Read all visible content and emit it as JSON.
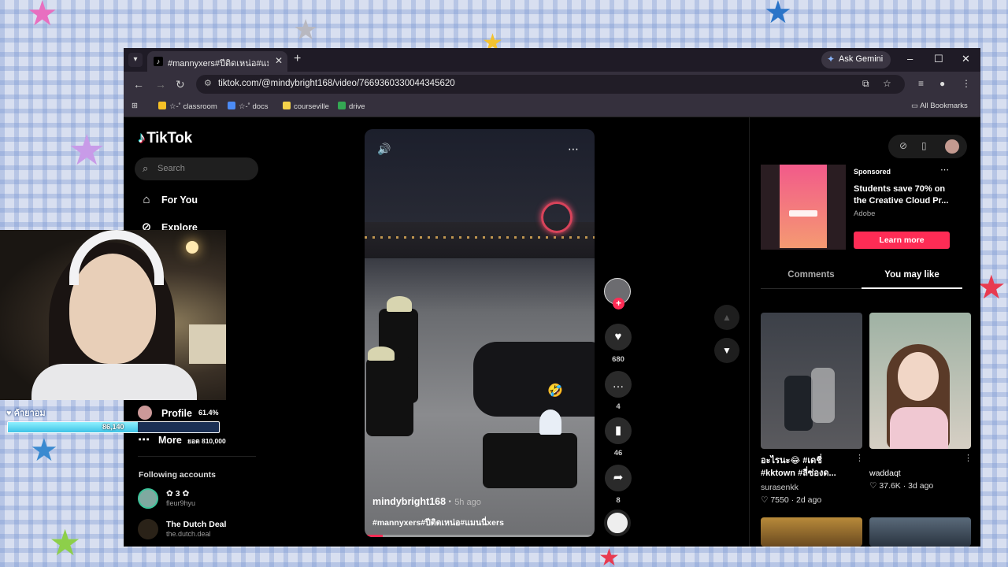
{
  "browser": {
    "tab_title": "#mannyxers#ปีติดเหน่อ#แมนนี่xers",
    "tab_favicon": "tiktok-icon",
    "gemini_label": "Ask Gemini",
    "url": "tiktok.com/@mindybright168/video/7669360330044345620",
    "bookmarks": [
      {
        "label": "☆-˚ classroom",
        "color": "#f6c026"
      },
      {
        "label": "☆-˚ docs",
        "color": "#4c8bf5"
      },
      {
        "label": "courseville",
        "color": "#f4d24a"
      },
      {
        "label": "drive",
        "color": "#34a853"
      }
    ],
    "all_bookmarks": "All Bookmarks"
  },
  "tiktok": {
    "logo": "TikTok",
    "search_placeholder": "Search",
    "nav": {
      "for_you": "For You",
      "explore": "Explore",
      "profile": "Profile",
      "more": "More"
    },
    "following_header": "Following accounts",
    "following": [
      {
        "name": "✿ 3 ✿",
        "handle": "fleur9hyu"
      },
      {
        "name": "The Dutch Deal",
        "handle": "the.dutch.deal"
      }
    ],
    "video": {
      "username": "mindybright168",
      "time": "5h ago",
      "caption": "#mannyxers#ปีติดเหน่อ#แมนนี่xers",
      "progress": 0.08
    },
    "actions": {
      "likes": "680",
      "comments": "4",
      "saves": "46",
      "shares": "8"
    },
    "ad": {
      "sponsored": "Sponsored",
      "title": "Students save 70% on the Creative Cloud Pr...",
      "brand": "Adobe",
      "cta": "Learn more"
    },
    "tabs": {
      "comments": "Comments",
      "you_may_like": "You may like"
    },
    "recommendations": [
      {
        "caption": "อะไรนะ😂 #เดชี่ #kktown #ลี่ซ่องด...",
        "user": "surasenkk",
        "likes": "7550",
        "age": "2d ago"
      },
      {
        "caption": "",
        "user": "waddaqt",
        "likes": "37.6K",
        "age": "3d ago"
      }
    ]
  },
  "stream_overlay": {
    "name": "ค้ายาอม",
    "bar_value": "86,140",
    "bar_fraction": 0.614,
    "percent": "61.4%",
    "goal": "ยอด 810,000"
  },
  "colors": {
    "tiktok_red": "#fe2c55",
    "tiktok_cyan": "#25f4ee"
  }
}
